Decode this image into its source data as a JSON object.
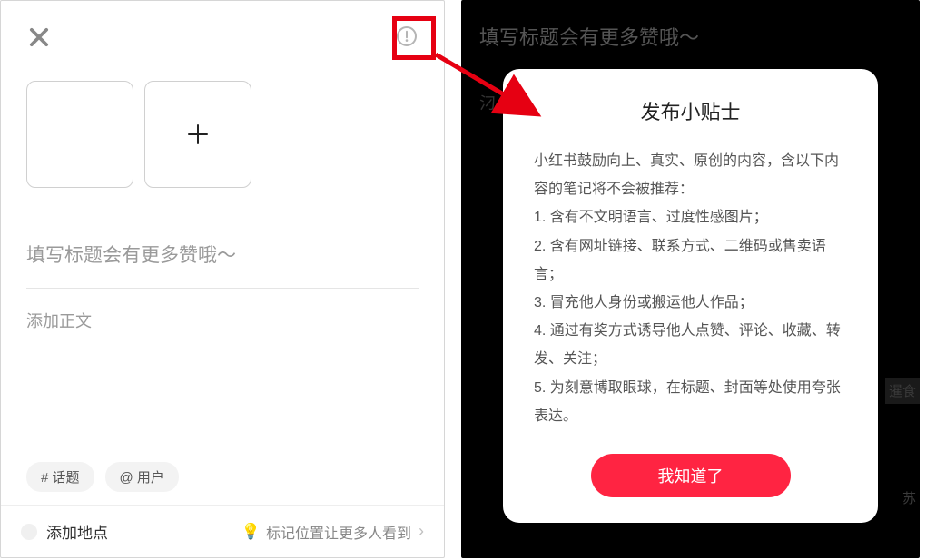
{
  "left": {
    "title_placeholder": "填写标题会有更多赞哦～",
    "body_placeholder": "添加正文",
    "topic_chip": "# 话题",
    "user_chip": "@ 用户",
    "add_location": "添加地点",
    "location_hint": "标记位置让更多人看到"
  },
  "right_bg": {
    "title": "填写标题会有更多赞哦～",
    "mid": "汈",
    "side1": "暹食",
    "side2": "苏"
  },
  "modal": {
    "title": "发布小贴士",
    "intro": "小红书鼓励向上、真实、原创的内容，含以下内容的笔记将不会被推荐：",
    "rule1": "1. 含有不文明语言、过度性感图片；",
    "rule2": "2. 含有网址链接、联系方式、二维码或售卖语言；",
    "rule3": "3. 冒充他人身份或搬运他人作品；",
    "rule4": "4. 通过有奖方式诱导他人点赞、评论、收藏、转发、关注；",
    "rule5": "5. 为刻意博取眼球，在标题、封面等处使用夸张表达。",
    "ok": "我知道了"
  }
}
